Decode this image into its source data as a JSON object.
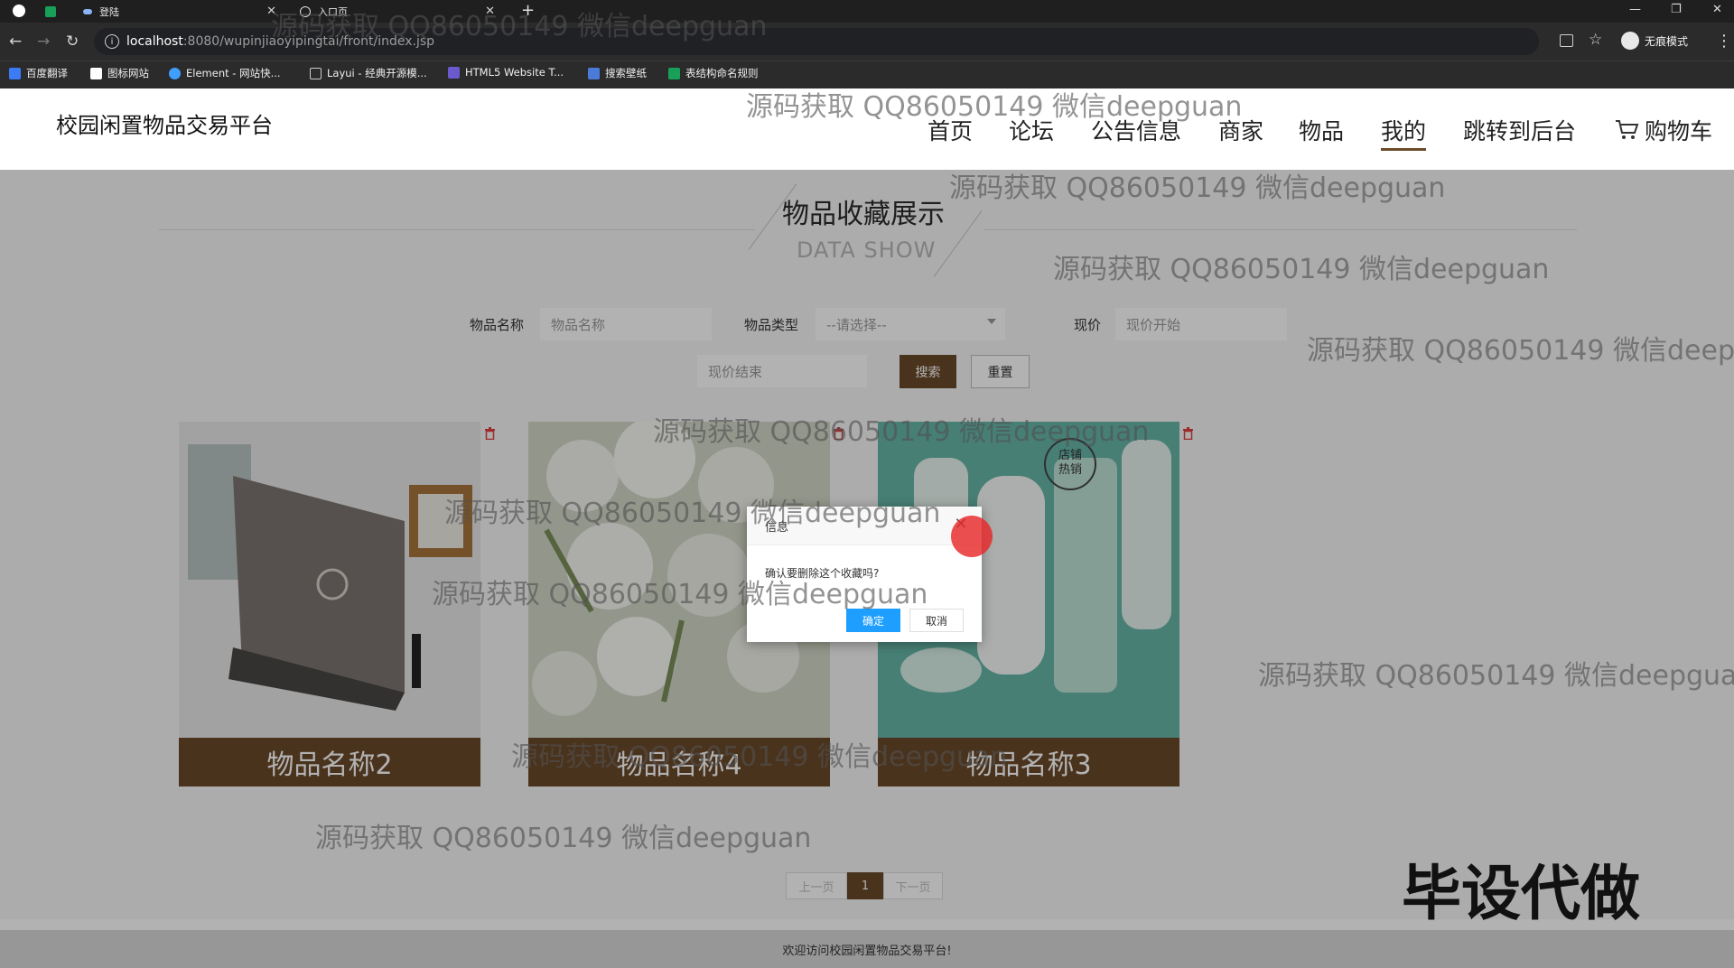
{
  "browser": {
    "tabs": [
      {
        "label": ""
      },
      {
        "label": ""
      },
      {
        "label": "登陆"
      },
      {
        "label": "入口页"
      }
    ],
    "new_tab": "+",
    "url_host": "localhost",
    "url_path": ":8080/wupinjiaoyipingtai/front/index.jsp",
    "incognito_label": "无痕模式",
    "bookmarks": [
      {
        "label": "百度翻译"
      },
      {
        "label": "图标网站"
      },
      {
        "label": "Element - 网站快..."
      },
      {
        "label": "Layui - 经典开源模..."
      },
      {
        "label": "HTML5 Website T..."
      },
      {
        "label": "搜索壁纸"
      },
      {
        "label": "表结构命名规则"
      }
    ]
  },
  "site": {
    "brand": "校园闲置物品交易平台",
    "nav": [
      {
        "label": "首页"
      },
      {
        "label": "论坛"
      },
      {
        "label": "公告信息"
      },
      {
        "label": "商家"
      },
      {
        "label": "物品"
      },
      {
        "label": "我的"
      },
      {
        "label": "跳转到后台"
      },
      {
        "label": "购物车"
      }
    ],
    "active_nav": "我的"
  },
  "section": {
    "title": "物品收藏展示",
    "subtitle": "DATA SHOW"
  },
  "search": {
    "name_label": "物品名称",
    "name_placeholder": "物品名称",
    "type_label": "物品类型",
    "type_value": "--请选择--",
    "price_label": "现价",
    "price_start_placeholder": "现价开始",
    "price_end_placeholder": "现价结束",
    "search_button": "搜索",
    "reset_button": "重置"
  },
  "items": [
    {
      "name": "物品名称2"
    },
    {
      "name": "物品名称4"
    },
    {
      "name": "物品名称3",
      "badge_line1": "店铺",
      "badge_line2": "热销"
    }
  ],
  "pagination": {
    "prev": "上一页",
    "current": "1",
    "next": "下一页"
  },
  "footer": {
    "text": "欢迎访问校园闲置物品交易平台!"
  },
  "dialog": {
    "title": "信息",
    "message": "确认要删除这个收藏吗?",
    "ok": "确定",
    "cancel": "取消"
  },
  "watermark": "源码获取 QQ86050149 微信deepguan",
  "promo": "毕设代做",
  "colors": {
    "brand_brown": "#6b4a2a",
    "dialog_primary": "#1e9fff",
    "chrome_dark": "#1f1f1f"
  }
}
